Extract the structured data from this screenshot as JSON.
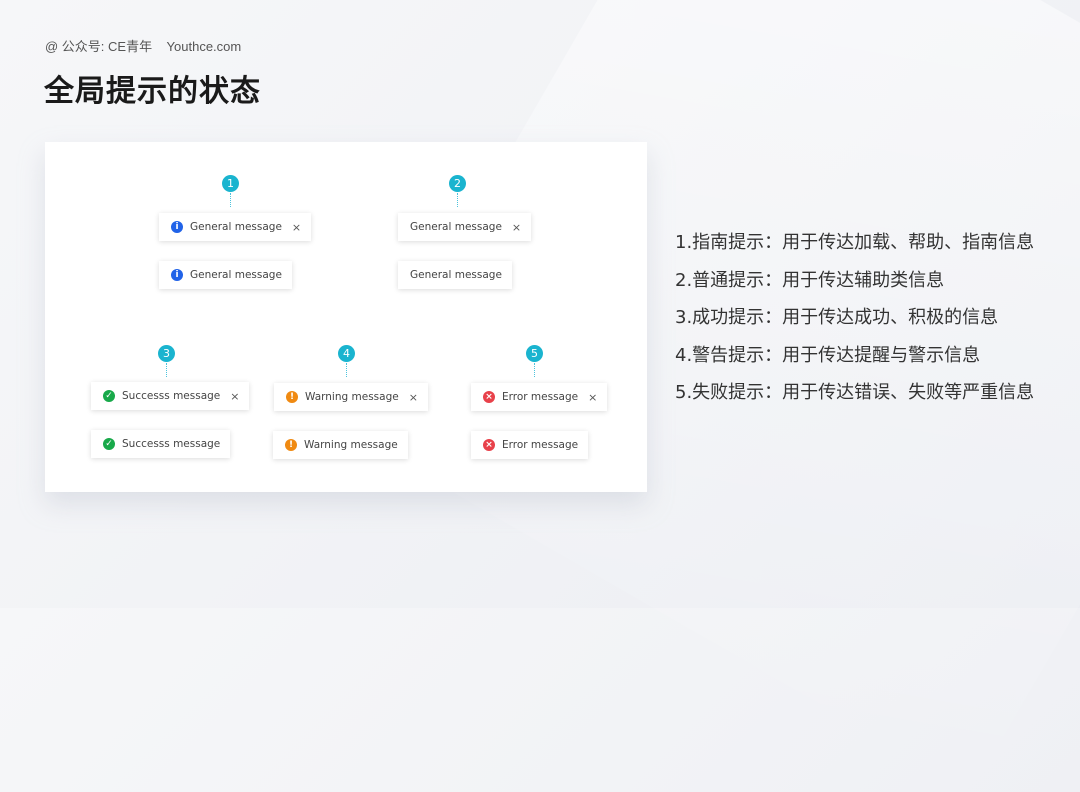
{
  "header": {
    "credit": "@ 公众号: CE青年    Youthce.com",
    "title": "全局提示的状态"
  },
  "colors": {
    "badge": "#1ab4cf",
    "info": "#2163e8",
    "success": "#18a94a",
    "warning": "#f08a12",
    "error": "#e8414a"
  },
  "groups": [
    {
      "number": "1",
      "messages": [
        {
          "text": "General message",
          "icon": "info-icon",
          "closable": true
        },
        {
          "text": "General message",
          "icon": "info-icon",
          "closable": false
        }
      ]
    },
    {
      "number": "2",
      "messages": [
        {
          "text": "General message",
          "icon": null,
          "closable": true
        },
        {
          "text": "General message",
          "icon": null,
          "closable": false
        }
      ]
    },
    {
      "number": "3",
      "messages": [
        {
          "text": "Successs message",
          "icon": "success-icon",
          "closable": true
        },
        {
          "text": "Successs message",
          "icon": "success-icon",
          "closable": false
        }
      ]
    },
    {
      "number": "4",
      "messages": [
        {
          "text": "Warning message",
          "icon": "warning-icon",
          "closable": true
        },
        {
          "text": "Warning message",
          "icon": "warning-icon",
          "closable": false
        }
      ]
    },
    {
      "number": "5",
      "messages": [
        {
          "text": "Error message",
          "icon": "error-icon",
          "closable": true
        },
        {
          "text": "Error message",
          "icon": "error-icon",
          "closable": false
        }
      ]
    }
  ],
  "close_glyph": "×",
  "icon_glyphs": {
    "info": "i",
    "success": "✓",
    "warning": "!",
    "error": "×"
  },
  "descriptions": [
    "1.指南提示：用于传达加载、帮助、指南信息",
    "2.普通提示：用于传达辅助类信息",
    "3.成功提示：用于传达成功、积极的信息",
    "4.警告提示：用于传达提醒与警示信息",
    "5.失败提示：用于传达错误、失败等严重信息"
  ]
}
